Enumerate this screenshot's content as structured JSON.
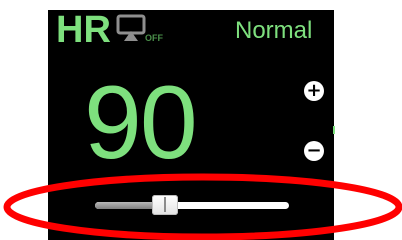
{
  "monitor": {
    "parameter_label": "HR",
    "mirroring_status": "OFF",
    "alarm_status": "Normal",
    "value": "90",
    "plus_symbol": "+",
    "minus_symbol": "−",
    "value_color": "#7ee07e",
    "background_color": "#000000"
  },
  "slider": {
    "level_fraction": 0.36
  },
  "annotation": {
    "color": "#ff0000"
  }
}
